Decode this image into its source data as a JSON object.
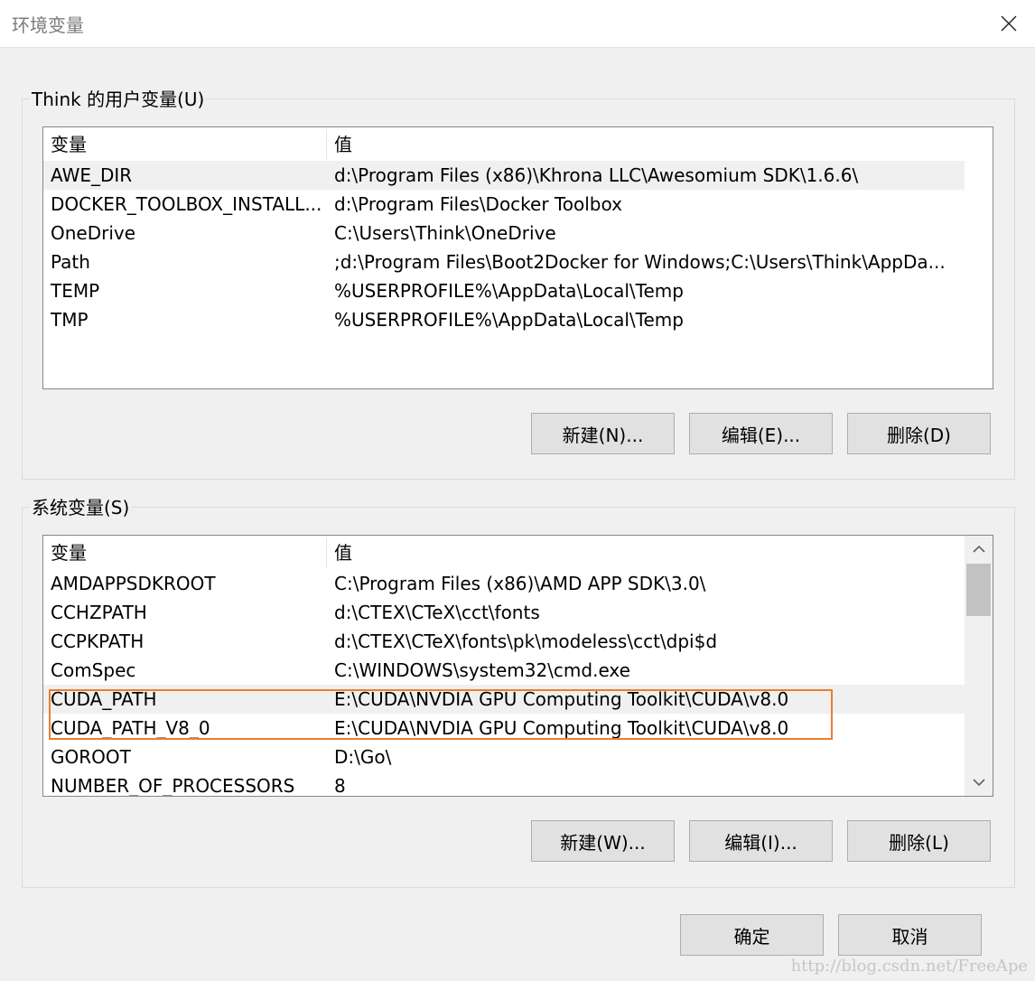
{
  "window": {
    "title": "环境变量"
  },
  "user_group": {
    "label": "Think 的用户变量(U)",
    "columns": [
      "变量",
      "值"
    ],
    "rows": [
      {
        "name": "AWE_DIR",
        "value": "d:\\Program Files (x86)\\Khrona LLC\\Awesomium SDK\\1.6.6\\"
      },
      {
        "name": "DOCKER_TOOLBOX_INSTALL...",
        "value": "d:\\Program Files\\Docker Toolbox"
      },
      {
        "name": "OneDrive",
        "value": "C:\\Users\\Think\\OneDrive"
      },
      {
        "name": "Path",
        "value": ";d:\\Program Files\\Boot2Docker for Windows;C:\\Users\\Think\\AppDa..."
      },
      {
        "name": "TEMP",
        "value": "%USERPROFILE%\\AppData\\Local\\Temp"
      },
      {
        "name": "TMP",
        "value": "%USERPROFILE%\\AppData\\Local\\Temp"
      }
    ],
    "buttons": {
      "new": "新建(N)...",
      "edit": "编辑(E)...",
      "delete": "删除(D)"
    }
  },
  "system_group": {
    "label": "系统变量(S)",
    "columns": [
      "变量",
      "值"
    ],
    "rows": [
      {
        "name": "AMDAPPSDKROOT",
        "value": "C:\\Program Files (x86)\\AMD APP SDK\\3.0\\"
      },
      {
        "name": "CCHZPATH",
        "value": "d:\\CTEX\\CTeX\\cct\\fonts"
      },
      {
        "name": "CCPKPATH",
        "value": "d:\\CTEX\\CTeX\\fonts\\pk\\modeless\\cct\\dpi$d"
      },
      {
        "name": "ComSpec",
        "value": "C:\\WINDOWS\\system32\\cmd.exe"
      },
      {
        "name": "CUDA_PATH",
        "value": "E:\\CUDA\\NVDIA GPU Computing Toolkit\\CUDA\\v8.0"
      },
      {
        "name": "CUDA_PATH_V8_0",
        "value": "E:\\CUDA\\NVDIA GPU Computing Toolkit\\CUDA\\v8.0"
      },
      {
        "name": "GOROOT",
        "value": "D:\\Go\\"
      },
      {
        "name": "NUMBER_OF_PROCESSORS",
        "value": "8"
      }
    ],
    "buttons": {
      "new": "新建(W)...",
      "edit": "编辑(I)...",
      "delete": "删除(L)"
    }
  },
  "footer": {
    "ok": "确定",
    "cancel": "取消"
  },
  "watermark": "http://blog.csdn.net/FreeApe",
  "colors": {
    "highlight": "#ed7d31",
    "selected_row": "#f0f0f0"
  },
  "icons": {
    "close": "close-icon",
    "scroll_up": "chevron-up-icon",
    "scroll_down": "chevron-down-icon"
  }
}
